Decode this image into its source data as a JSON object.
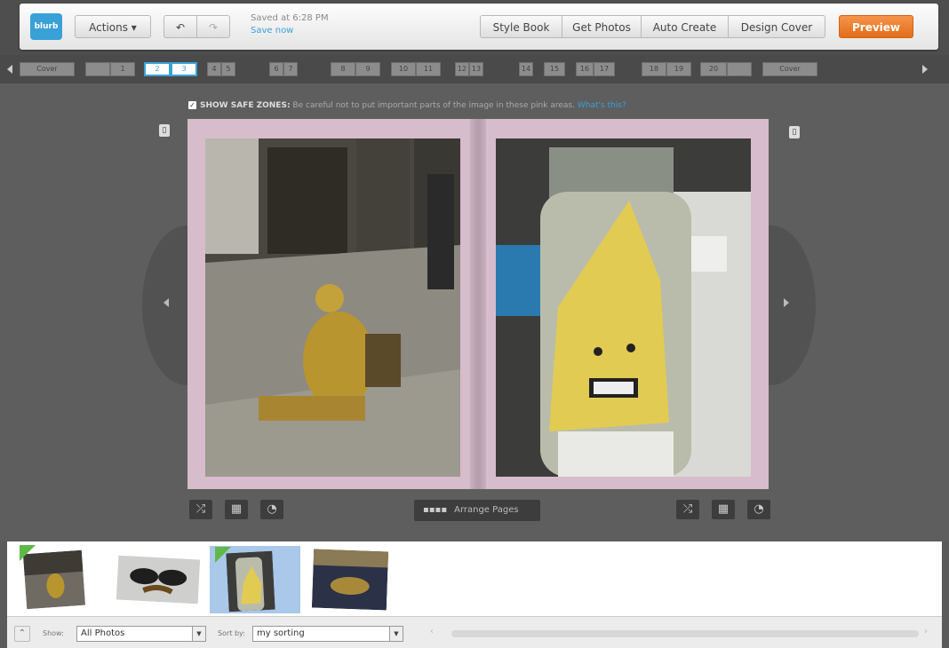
{
  "toolbar": {
    "logo": "blurb",
    "actions_label": "Actions ▾",
    "undo_icon": "undo-icon",
    "redo_icon": "redo-icon",
    "saved_text": "Saved at 6:28 PM",
    "save_now": "Save now",
    "buttons": [
      "Style Book",
      "Get Photos",
      "Auto Create",
      "Design Cover"
    ],
    "preview": "Preview"
  },
  "nav": {
    "pages": [
      "Cover",
      "",
      "1",
      "2",
      "3",
      "4",
      "5",
      "6",
      "7",
      "8",
      "9",
      "10",
      "11",
      "12",
      "13",
      "14",
      "15",
      "16",
      "17",
      "18",
      "19",
      "20",
      "",
      "Cover"
    ],
    "active_pages": [
      "2",
      "3"
    ]
  },
  "safe_zone": {
    "checked": true,
    "label": "SHOW SAFE ZONES:",
    "message": "Be careful not to put important parts of the image in these pink areas.",
    "link": "What's this?"
  },
  "spread": {
    "left_photo": "gold-statue-street-performer",
    "right_photo": "bottle-with-angry-face"
  },
  "controls": {
    "arrange_label": "Arrange Pages",
    "left_tools": [
      "shuffle-icon",
      "layout-icon",
      "palette-icon"
    ],
    "right_tools": [
      "shuffle-icon",
      "layout-icon",
      "palette-icon"
    ]
  },
  "tray": {
    "thumbnails": [
      {
        "name": "gold-statue",
        "used": true,
        "selected": false
      },
      {
        "name": "sunglasses-mustache",
        "used": false,
        "selected": false
      },
      {
        "name": "bottle-face",
        "used": true,
        "selected": true
      },
      {
        "name": "sign-photo",
        "used": false,
        "selected": false
      }
    ]
  },
  "footer": {
    "show_label": "Show:",
    "show_value": "All Photos",
    "sort_label": "Sort by:",
    "sort_value": "my sorting"
  },
  "colors": {
    "accent_blue": "#3aa0d8",
    "preview_orange": "#e9782a",
    "safe_zone_pink": "#d7bccc",
    "used_green": "#5fb94a"
  }
}
